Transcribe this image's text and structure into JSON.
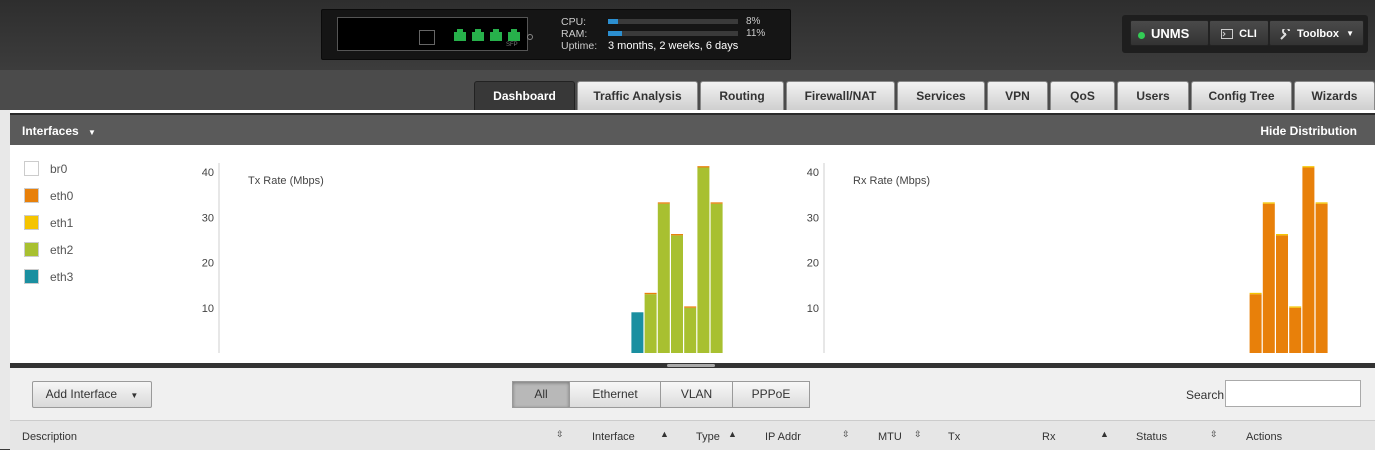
{
  "header": {
    "sfp_label": "SFP",
    "cpu_label": "CPU:",
    "cpu_percent": 8,
    "cpu_text": "8%",
    "ram_label": "RAM:",
    "ram_percent": 11,
    "ram_text": "11%",
    "uptime_label": "Uptime:",
    "uptime_value": "3 months, 2 weeks, 6 days",
    "buttons": {
      "unms": "UNMS",
      "cli": "CLI",
      "toolbox": "Toolbox"
    },
    "unms_status_color": "#33cc55"
  },
  "tabs": [
    {
      "label": "Dashboard",
      "active": true
    },
    {
      "label": "Traffic Analysis"
    },
    {
      "label": "Routing"
    },
    {
      "label": "Firewall/NAT"
    },
    {
      "label": "Services"
    },
    {
      "label": "VPN"
    },
    {
      "label": "QoS"
    },
    {
      "label": "Users"
    },
    {
      "label": "Config Tree"
    },
    {
      "label": "Wizards"
    }
  ],
  "section": {
    "title": "Interfaces",
    "hide_label": "Hide Distribution"
  },
  "legend": [
    {
      "label": "br0",
      "color": "#ffffff"
    },
    {
      "label": "eth0",
      "color": "#e8800a"
    },
    {
      "label": "eth1",
      "color": "#f5c400"
    },
    {
      "label": "eth2",
      "color": "#a8c030"
    },
    {
      "label": "eth3",
      "color": "#1a8fa0"
    }
  ],
  "chart_data": [
    {
      "type": "bar",
      "title": "Tx Rate (Mbps)",
      "ylim": [
        0,
        42
      ],
      "yticks": [
        10,
        20,
        30,
        40
      ],
      "stacked": true,
      "series": [
        {
          "name": "eth3",
          "color": "#1a8fa0",
          "values": [
            0,
            0,
            0,
            0,
            0,
            0,
            0,
            9,
            0,
            0,
            0,
            0,
            0,
            0,
            0
          ]
        },
        {
          "name": "eth2",
          "color": "#a8c030",
          "values": [
            0,
            0,
            0,
            0,
            0,
            0,
            0,
            0,
            13,
            33,
            26,
            10,
            41,
            33,
            0
          ]
        },
        {
          "name": "eth0",
          "color": "#e8800a",
          "values": [
            0,
            0,
            0,
            0,
            0,
            0,
            0,
            0,
            0.3,
            0.3,
            0.3,
            0.3,
            0.3,
            0.3,
            0
          ]
        }
      ]
    },
    {
      "type": "bar",
      "title": "Rx Rate (Mbps)",
      "ylim": [
        0,
        42
      ],
      "yticks": [
        10,
        20,
        30,
        40
      ],
      "stacked": true,
      "series": [
        {
          "name": "eth0",
          "color": "#e8800a",
          "values": [
            0,
            0,
            0,
            0,
            0,
            0,
            0,
            0,
            13,
            33,
            26,
            10,
            41,
            33,
            0
          ]
        },
        {
          "name": "eth1",
          "color": "#f5c400",
          "values": [
            0,
            0,
            0,
            0,
            0,
            0,
            0,
            0,
            0.3,
            0.3,
            0.3,
            0.3,
            0.3,
            0.3,
            0
          ]
        }
      ]
    }
  ],
  "toolbar": {
    "add_interface": "Add Interface",
    "filters": [
      "All",
      "Ethernet",
      "VLAN",
      "PPPoE"
    ],
    "active_filter": "All",
    "search_label": "Search",
    "search_value": ""
  },
  "table": {
    "columns": [
      "Description",
      "Interface",
      "Type",
      "IP Addr",
      "MTU",
      "Tx",
      "Rx",
      "Status",
      "Actions"
    ]
  }
}
